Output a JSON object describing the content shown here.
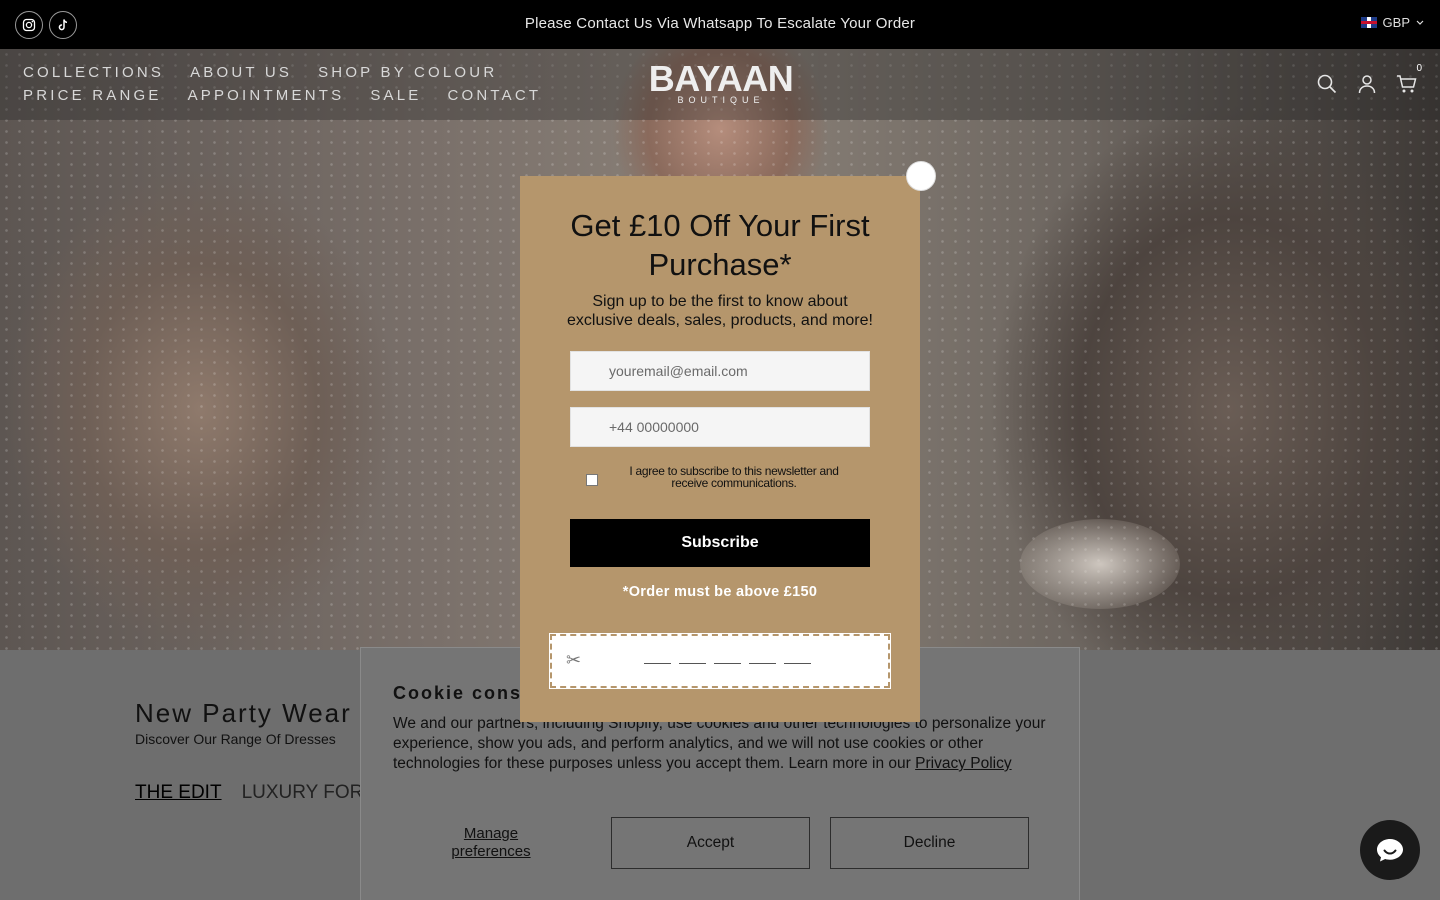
{
  "announcement": {
    "message": "Please Contact Us Via Whatsapp To Escalate Your Order",
    "currency": "GBP",
    "socials": [
      "instagram-icon",
      "tiktok-icon"
    ]
  },
  "nav": {
    "row1": [
      "COLLECTIONS",
      "ABOUT US",
      "SHOP BY COLOUR"
    ],
    "row2": [
      "PRICE RANGE",
      "APPOINTMENTS",
      "SALE",
      "CONTACT"
    ],
    "logo": {
      "name": "BAYAAN",
      "tagline": "BOUTIQUE"
    },
    "cart_count": "0",
    "icons": [
      "search-icon",
      "account-icon",
      "cart-icon"
    ]
  },
  "section": {
    "title": "New Party Wear",
    "subtitle": "Discover Our Range Of Dresses",
    "tabs": [
      "THE EDIT",
      "LUXURY FORM"
    ]
  },
  "popup": {
    "title": "Get £10 Off Your First Purchase*",
    "text": "Sign up to be the first to know about exclusive deals, sales, products, and more!",
    "email_placeholder": "youremail@email.com",
    "phone_placeholder": "+44 00000000",
    "agree_text": "I agree to subscribe to this newsletter and receive communications.",
    "subscribe_label": "Subscribe",
    "note": "*Order must be above £150",
    "colors": {
      "background": "#b5966c",
      "button": "#000000"
    }
  },
  "cookie": {
    "title": "Cookie cons",
    "text": "We and our partners, including Shopify, use cookies and other technologies to personalize your experience, show you ads, and perform analytics, and we will not use cookies or other technologies for these purposes unless you accept them. Learn more in our",
    "link": "Privacy Policy",
    "manage": "Manage preferences",
    "accept": "Accept",
    "decline": "Decline"
  }
}
